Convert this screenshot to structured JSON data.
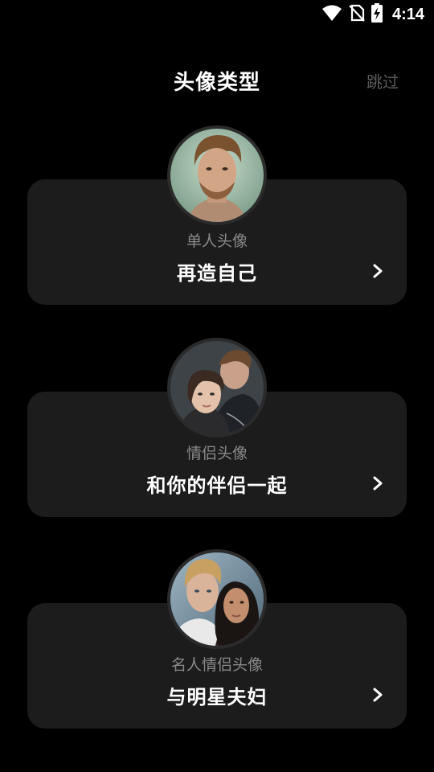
{
  "status_bar": {
    "time": "4:14",
    "icons": [
      "wifi-icon",
      "no-sim-icon",
      "battery-charging-icon"
    ]
  },
  "header": {
    "title": "头像类型",
    "skip_label": "跳过"
  },
  "cards": [
    {
      "subtitle": "单人头像",
      "title": "再造自己",
      "avatar": "single-man-portrait"
    },
    {
      "subtitle": "情侣头像",
      "title": "和你的伴侣一起",
      "avatar": "couple-portrait"
    },
    {
      "subtitle": "名人情侣头像",
      "title": "与明星夫妇",
      "avatar": "celebrity-couple-portrait"
    }
  ],
  "colors": {
    "background": "#000000",
    "card": "#1c1c1c",
    "subtitle": "#8a8a8a",
    "skip": "#5c5c5c"
  }
}
